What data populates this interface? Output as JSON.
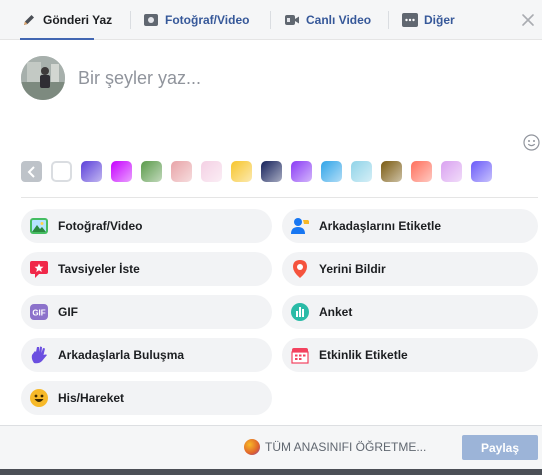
{
  "colors": {
    "accent": "#4267b2",
    "link": "#365899",
    "share_disabled": "#9cb4d8",
    "pill_bg": "#f2f3f5"
  },
  "tabs": [
    {
      "label": "Gönderi Yaz",
      "icon": "pencil-icon"
    },
    {
      "label": "Fotoğraf/Video",
      "icon": "camera-icon"
    },
    {
      "label": "Canlı Video",
      "icon": "live-video-icon"
    },
    {
      "label": "Diğer",
      "icon": "more-icon"
    }
  ],
  "composer": {
    "placeholder": "Bir şeyler yaz...",
    "value": ""
  },
  "swatches": [
    "#f0f2f5",
    "#5b3fd9",
    "#c600ff",
    "#5a9a4a",
    "#e8a3a7",
    "#f4d0e4",
    "#f7c52b",
    "#14205a",
    "#8a3bf5",
    "#2fa4e8",
    "#8fd3e8",
    "#7a5a10",
    "#ff6f5b",
    "#d9a1f0",
    "#6a5af9"
  ],
  "actions": [
    {
      "label": "Fotoğraf/Video",
      "icon": "photo-icon"
    },
    {
      "label": "Arkadaşlarını Etiketle",
      "icon": "tag-friends-icon"
    },
    {
      "label": "Tavsiyeler İste",
      "icon": "recommendation-icon"
    },
    {
      "label": "Yerini Bildir",
      "icon": "location-pin-icon"
    },
    {
      "label": "GIF",
      "icon": "gif-icon"
    },
    {
      "label": "Anket",
      "icon": "poll-icon"
    },
    {
      "label": "Arkadaşlarla Buluşma",
      "icon": "wave-hand-icon"
    },
    {
      "label": "Etkinlik Etiketle",
      "icon": "calendar-icon"
    },
    {
      "label": "His/Hareket",
      "icon": "smiley-icon"
    }
  ],
  "footer": {
    "audience": "TÜM ANASINIFI ÖĞRETME...",
    "share_label": "Paylaş"
  }
}
